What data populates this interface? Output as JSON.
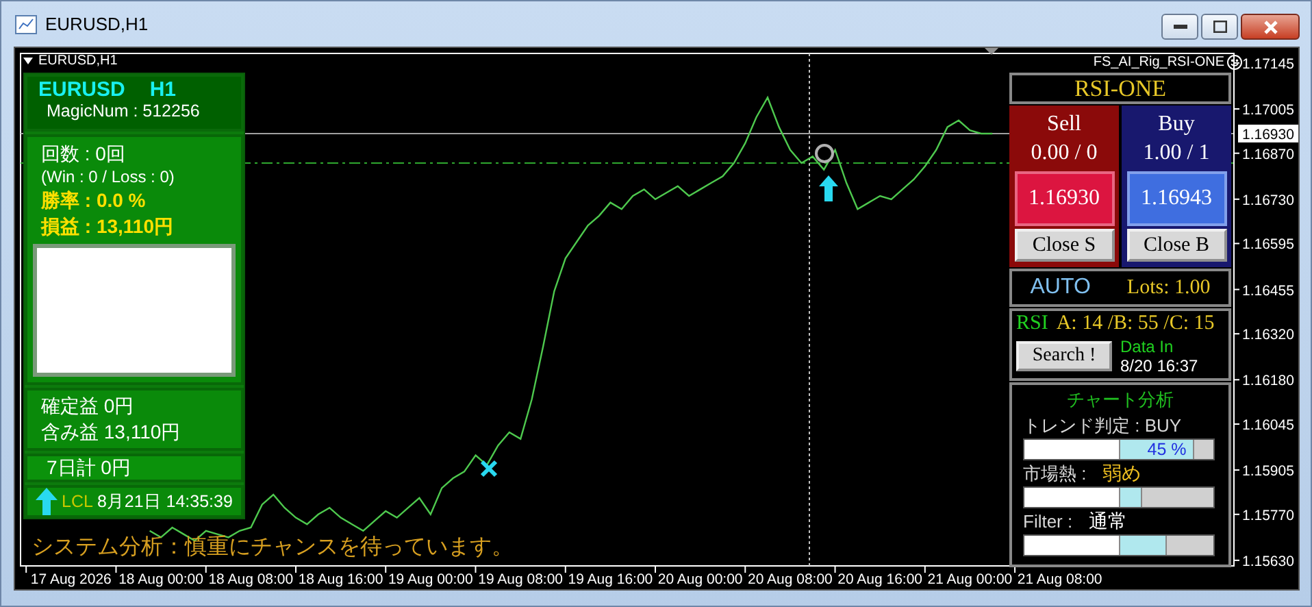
{
  "window": {
    "title": "EURUSD,H1"
  },
  "chart": {
    "symbol_label": "EURUSD,H1",
    "indicator_label": "FS_AI_Rig_RSI-ONE",
    "chart_data": {
      "type": "line",
      "series": [
        {
          "color": "#4ec94e",
          "values": [
            null,
            null,
            null,
            null,
            null,
            null,
            null,
            null,
            null,
            null,
            null,
            1.1572,
            1.157,
            1.1573,
            1.1571,
            1.1569,
            1.1572,
            1.1571,
            1.157,
            1.1572,
            1.1573,
            1.158,
            1.1583,
            1.1579,
            1.1576,
            1.1574,
            1.1577,
            1.1579,
            1.1576,
            1.1574,
            1.1572,
            1.1575,
            1.1578,
            1.1576,
            1.1579,
            1.1582,
            1.1577,
            1.1585,
            1.1588,
            1.159,
            1.1595,
            1.1592,
            1.1598,
            1.1602,
            1.16,
            1.1612,
            1.1628,
            1.1645,
            1.1655,
            1.166,
            1.1665,
            1.1668,
            1.1672,
            1.167,
            1.1674,
            1.1676,
            1.1673,
            1.1675,
            1.1677,
            1.1674,
            1.1676,
            1.1678,
            1.168,
            1.1684,
            1.169,
            1.1698,
            1.1704,
            1.1695,
            1.1688,
            1.1684,
            1.1686,
            1.1682,
            1.1688,
            1.1678,
            1.167,
            1.1672,
            1.1674,
            1.1673,
            1.1676,
            1.1679,
            1.1683,
            1.1688,
            1.1695,
            1.1697,
            1.1694,
            1.1693,
            1.1693,
            null,
            null,
            null,
            null,
            null,
            null,
            null,
            null,
            null,
            null,
            null,
            null,
            null,
            null,
            null,
            null,
            null,
            null,
            null,
            null,
            null
          ]
        }
      ],
      "categories": [
        null,
        null,
        null,
        null,
        "17 Aug 2026",
        null,
        null,
        null,
        null,
        null,
        null,
        null,
        "18 Aug 00:00",
        null,
        null,
        null,
        null,
        null,
        null,
        null,
        "18 Aug 08:00",
        null,
        null,
        null,
        null,
        null,
        null,
        null,
        "18 Aug 16:00",
        null,
        null,
        null,
        null,
        null,
        null,
        null,
        "19 Aug 00:00",
        null,
        null,
        null,
        null,
        null,
        null,
        null,
        "19 Aug 08:00",
        null,
        null,
        null,
        null,
        null,
        null,
        null,
        "19 Aug 16:00",
        null,
        null,
        null,
        null,
        null,
        null,
        null,
        "20 Aug 00:00",
        null,
        null,
        null,
        null,
        null,
        null,
        null,
        "20 Aug 08:00",
        null,
        null,
        null,
        null,
        null,
        null,
        null,
        "20 Aug 16:00",
        null,
        null,
        null,
        null,
        null,
        null,
        null,
        "21 Aug 00:00",
        null,
        null,
        null,
        null,
        null,
        null,
        null,
        "21 Aug 08:00",
        null,
        null,
        null,
        null,
        null,
        null,
        null,
        null,
        null,
        null,
        null,
        null,
        null,
        null,
        null
      ],
      "ylim": [
        1.15613,
        1.17174
      ],
      "yticks": [
        {
          "value": 1.17145,
          "label": "1.17145"
        },
        {
          "value": 1.17005,
          "label": "1.17005"
        },
        {
          "value": 1.1687,
          "label": "1.16870"
        },
        {
          "value": 1.1673,
          "label": "1.16730"
        },
        {
          "value": 1.16595,
          "label": "1.16595"
        },
        {
          "value": 1.16455,
          "label": "1.16455"
        },
        {
          "value": 1.1632,
          "label": "1.16320"
        },
        {
          "value": 1.1618,
          "label": "1.16180"
        },
        {
          "value": 1.16045,
          "label": "1.16045"
        },
        {
          "value": 1.15905,
          "label": "1.15905"
        },
        {
          "value": 1.1577,
          "label": "1.15770"
        },
        {
          "value": 1.1563,
          "label": "1.15630"
        }
      ],
      "ref_lines": [
        {
          "axis": "y",
          "value": 1.1693,
          "label": "1.16930",
          "color": "#a0a0a0"
        },
        {
          "axis": "y",
          "value": 1.1684,
          "color": "#2fa82f"
        }
      ]
    }
  },
  "info_panel": {
    "symbol": "EURUSD",
    "timeframe": "H1",
    "magic": "MagicNum : 512256",
    "trades": "回数 : 0回",
    "win_loss": "(Win : 0 /  Loss : 0)",
    "win_rate": "勝率 : 0.0 %",
    "profit": "損益 : 13,110円",
    "realized": "確定益 0円",
    "unrealized": "含み益 13,110円",
    "week_total": "7日計 0円",
    "clock_label": "LCL",
    "clock": "8月21日 14:35:39"
  },
  "status_message": "システム分析：慎重にチャンスを待っています。",
  "trade_panel": {
    "title": "RSI-ONE",
    "sides": [
      {
        "kind": "sell",
        "label": "Sell",
        "position": "0.00 / 0",
        "price": "1.16930",
        "close": "Close S"
      },
      {
        "kind": "buy",
        "label": "Buy",
        "position": "1.00 / 1",
        "price": "1.16943",
        "close": "Close B"
      }
    ],
    "mode": "AUTO",
    "lots": "Lots: 1.00",
    "rsi_label": "RSI",
    "rsi_values": "A: 14 /B: 55 /C: 15",
    "search_button": "Search !",
    "data_label": "Data In",
    "data_time": "8/20 16:37",
    "analysis": {
      "title": "チャート分析",
      "meters": [
        {
          "label": "トレンド判定 : BUY",
          "level": 0.78,
          "reading": "45 %"
        },
        {
          "label": "市場熱 :",
          "value": "弱め",
          "color": "#f0c020",
          "level": 0.22
        },
        {
          "label": "Filter :",
          "value": "通常",
          "color": "#ffffff",
          "level": 0.49
        }
      ]
    }
  }
}
